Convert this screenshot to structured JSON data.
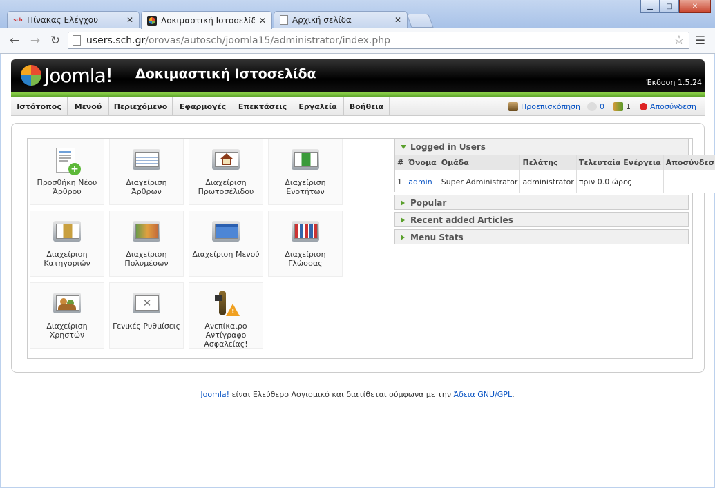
{
  "browser": {
    "tabs": [
      {
        "label": "Πίνακας Ελέγχου",
        "favicon": "sch"
      },
      {
        "label": "Δοκιμαστική Ιστοσελίδα - Δια",
        "favicon": "joomla"
      },
      {
        "label": "Αρχική σελίδα",
        "favicon": "page"
      }
    ],
    "url_host": "users.sch.gr",
    "url_path": "/orovas/autosch/joomla15/administrator/index.php"
  },
  "joomla": {
    "logo_text": "Joomla!",
    "site_name": "Δοκιμαστική Ιστοσελίδα",
    "version": "Έκδοση 1.5.24",
    "menu": [
      "Ιστότοπος",
      "Μενού",
      "Περιεχόμενο",
      "Εφαρμογές",
      "Επεκτάσεις",
      "Εργαλεία",
      "Βοήθεια"
    ],
    "status": {
      "preview": "Προεπισκόπηση",
      "messages": "0",
      "users": "1",
      "logout": "Αποσύνδεση"
    }
  },
  "quickicons": [
    {
      "label": "Προσθήκη Νέου Άρθρου",
      "icon": "add-article-icon"
    },
    {
      "label": "Διαχείριση Άρθρων",
      "icon": "articles-icon"
    },
    {
      "label": "Διαχείριση Πρωτοσέλιδου",
      "icon": "frontpage-icon"
    },
    {
      "label": "Διαχείριση Ενοτήτων",
      "icon": "sections-icon"
    },
    {
      "label": "Διαχείριση Κατηγοριών",
      "icon": "categories-icon"
    },
    {
      "label": "Διαχείριση Πολυμέσων",
      "icon": "media-icon"
    },
    {
      "label": "Διαχείριση Μενού",
      "icon": "menu-icon"
    },
    {
      "label": "Διαχείριση Γλώσσας",
      "icon": "language-icon"
    },
    {
      "label": "Διαχείριση Χρηστών",
      "icon": "users-icon"
    },
    {
      "label": "Γενικές Ρυθμίσεις",
      "icon": "config-icon"
    },
    {
      "label": "Ανεπίκαιρο Αντίγραφο Ασφαλείας!",
      "icon": "backup-warning-icon"
    }
  ],
  "logged_users": {
    "title": "Logged in Users",
    "headers": [
      "#",
      "Όνομα",
      "Ομάδα",
      "Πελάτης",
      "Τελευταία Ενέργεια",
      "Αποσύνδεση"
    ],
    "rows": [
      [
        "1",
        "admin",
        "Super Administrator",
        "administrator",
        "πριν 0.0 ώρες",
        ""
      ]
    ]
  },
  "panels": [
    "Popular",
    "Recent added Articles",
    "Menu Stats"
  ],
  "footer": {
    "link1": "Joomla!",
    "text": " είναι Ελεύθερο Λογισμικό και διατίθεται σύμφωνα με την ",
    "link2": "Άδεια GNU/GPL",
    "end": "."
  }
}
